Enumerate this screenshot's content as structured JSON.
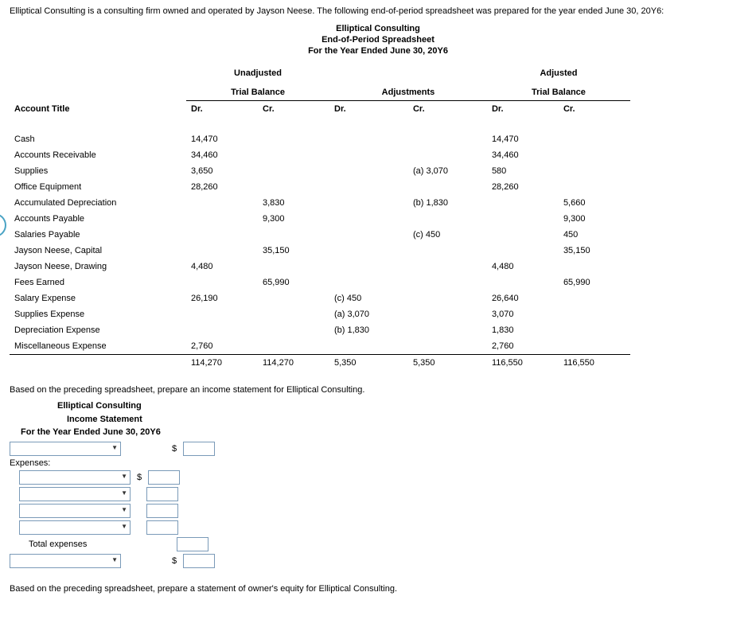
{
  "intro": "Elliptical Consulting is a consulting firm owned and operated by Jayson Neese. The following end-of-period spreadsheet was prepared for the year ended June 30, 20Y6:",
  "header": {
    "company": "Elliptical Consulting",
    "title": "End-of-Period Spreadsheet",
    "period": "For the Year Ended June 30, 20Y6"
  },
  "groups": {
    "unadj": "Unadjusted",
    "unadj2": "Trial Balance",
    "adjm": "Adjustments",
    "adj": "Adjusted",
    "adj2": "Trial Balance"
  },
  "cols": {
    "acct": "Account Title",
    "dr": "Dr.",
    "cr": "Cr."
  },
  "rows": [
    {
      "acct": "Cash",
      "udr": "14,470",
      "ucr": "",
      "adr": "",
      "acr": "",
      "jdr": "14,470",
      "jcr": ""
    },
    {
      "acct": "Accounts Receivable",
      "udr": "34,460",
      "ucr": "",
      "adr": "",
      "acr": "",
      "jdr": "34,460",
      "jcr": ""
    },
    {
      "acct": "Supplies",
      "udr": "3,650",
      "ucr": "",
      "adr": "",
      "acr": "(a) 3,070",
      "jdr": "580",
      "jcr": ""
    },
    {
      "acct": "Office Equipment",
      "udr": "28,260",
      "ucr": "",
      "adr": "",
      "acr": "",
      "jdr": "28,260",
      "jcr": ""
    },
    {
      "acct": "Accumulated Depreciation",
      "udr": "",
      "ucr": "3,830",
      "adr": "",
      "acr": "(b) 1,830",
      "jdr": "",
      "jcr": "5,660"
    },
    {
      "acct": "Accounts Payable",
      "udr": "",
      "ucr": "9,300",
      "adr": "",
      "acr": "",
      "jdr": "",
      "jcr": "9,300"
    },
    {
      "acct": "Salaries Payable",
      "udr": "",
      "ucr": "",
      "adr": "",
      "acr": "(c) 450",
      "jdr": "",
      "jcr": "450"
    },
    {
      "acct": "Jayson Neese, Capital",
      "udr": "",
      "ucr": "35,150",
      "adr": "",
      "acr": "",
      "jdr": "",
      "jcr": "35,150"
    },
    {
      "acct": "Jayson Neese, Drawing",
      "udr": "4,480",
      "ucr": "",
      "adr": "",
      "acr": "",
      "jdr": "4,480",
      "jcr": ""
    },
    {
      "acct": "Fees Earned",
      "udr": "",
      "ucr": "65,990",
      "adr": "",
      "acr": "",
      "jdr": "",
      "jcr": "65,990"
    },
    {
      "acct": "Salary Expense",
      "udr": "26,190",
      "ucr": "",
      "adr": "(c) 450",
      "acr": "",
      "jdr": "26,640",
      "jcr": ""
    },
    {
      "acct": "Supplies Expense",
      "udr": "",
      "ucr": "",
      "adr": "(a) 3,070",
      "acr": "",
      "jdr": "3,070",
      "jcr": ""
    },
    {
      "acct": "Depreciation Expense",
      "udr": "",
      "ucr": "",
      "adr": "(b) 1,830",
      "acr": "",
      "jdr": "1,830",
      "jcr": ""
    },
    {
      "acct": "Miscellaneous Expense",
      "udr": "2,760",
      "ucr": "",
      "adr": "",
      "acr": "",
      "jdr": "2,760",
      "jcr": ""
    }
  ],
  "totals": {
    "udr": "114,270",
    "ucr": "114,270",
    "adr": "5,350",
    "acr": "5,350",
    "jdr": "116,550",
    "jcr": "116,550"
  },
  "q1": "Based on the preceding spreadsheet, prepare an income statement for Elliptical Consulting.",
  "inc": {
    "company": "Elliptical Consulting",
    "title": "Income Statement",
    "period": "For the Year Ended June 30, 20Y6",
    "expenses_label": "Expenses:",
    "total_expenses": "Total expenses"
  },
  "q2": "Based on the preceding spreadsheet, prepare a statement of owner's equity for Elliptical Consulting."
}
